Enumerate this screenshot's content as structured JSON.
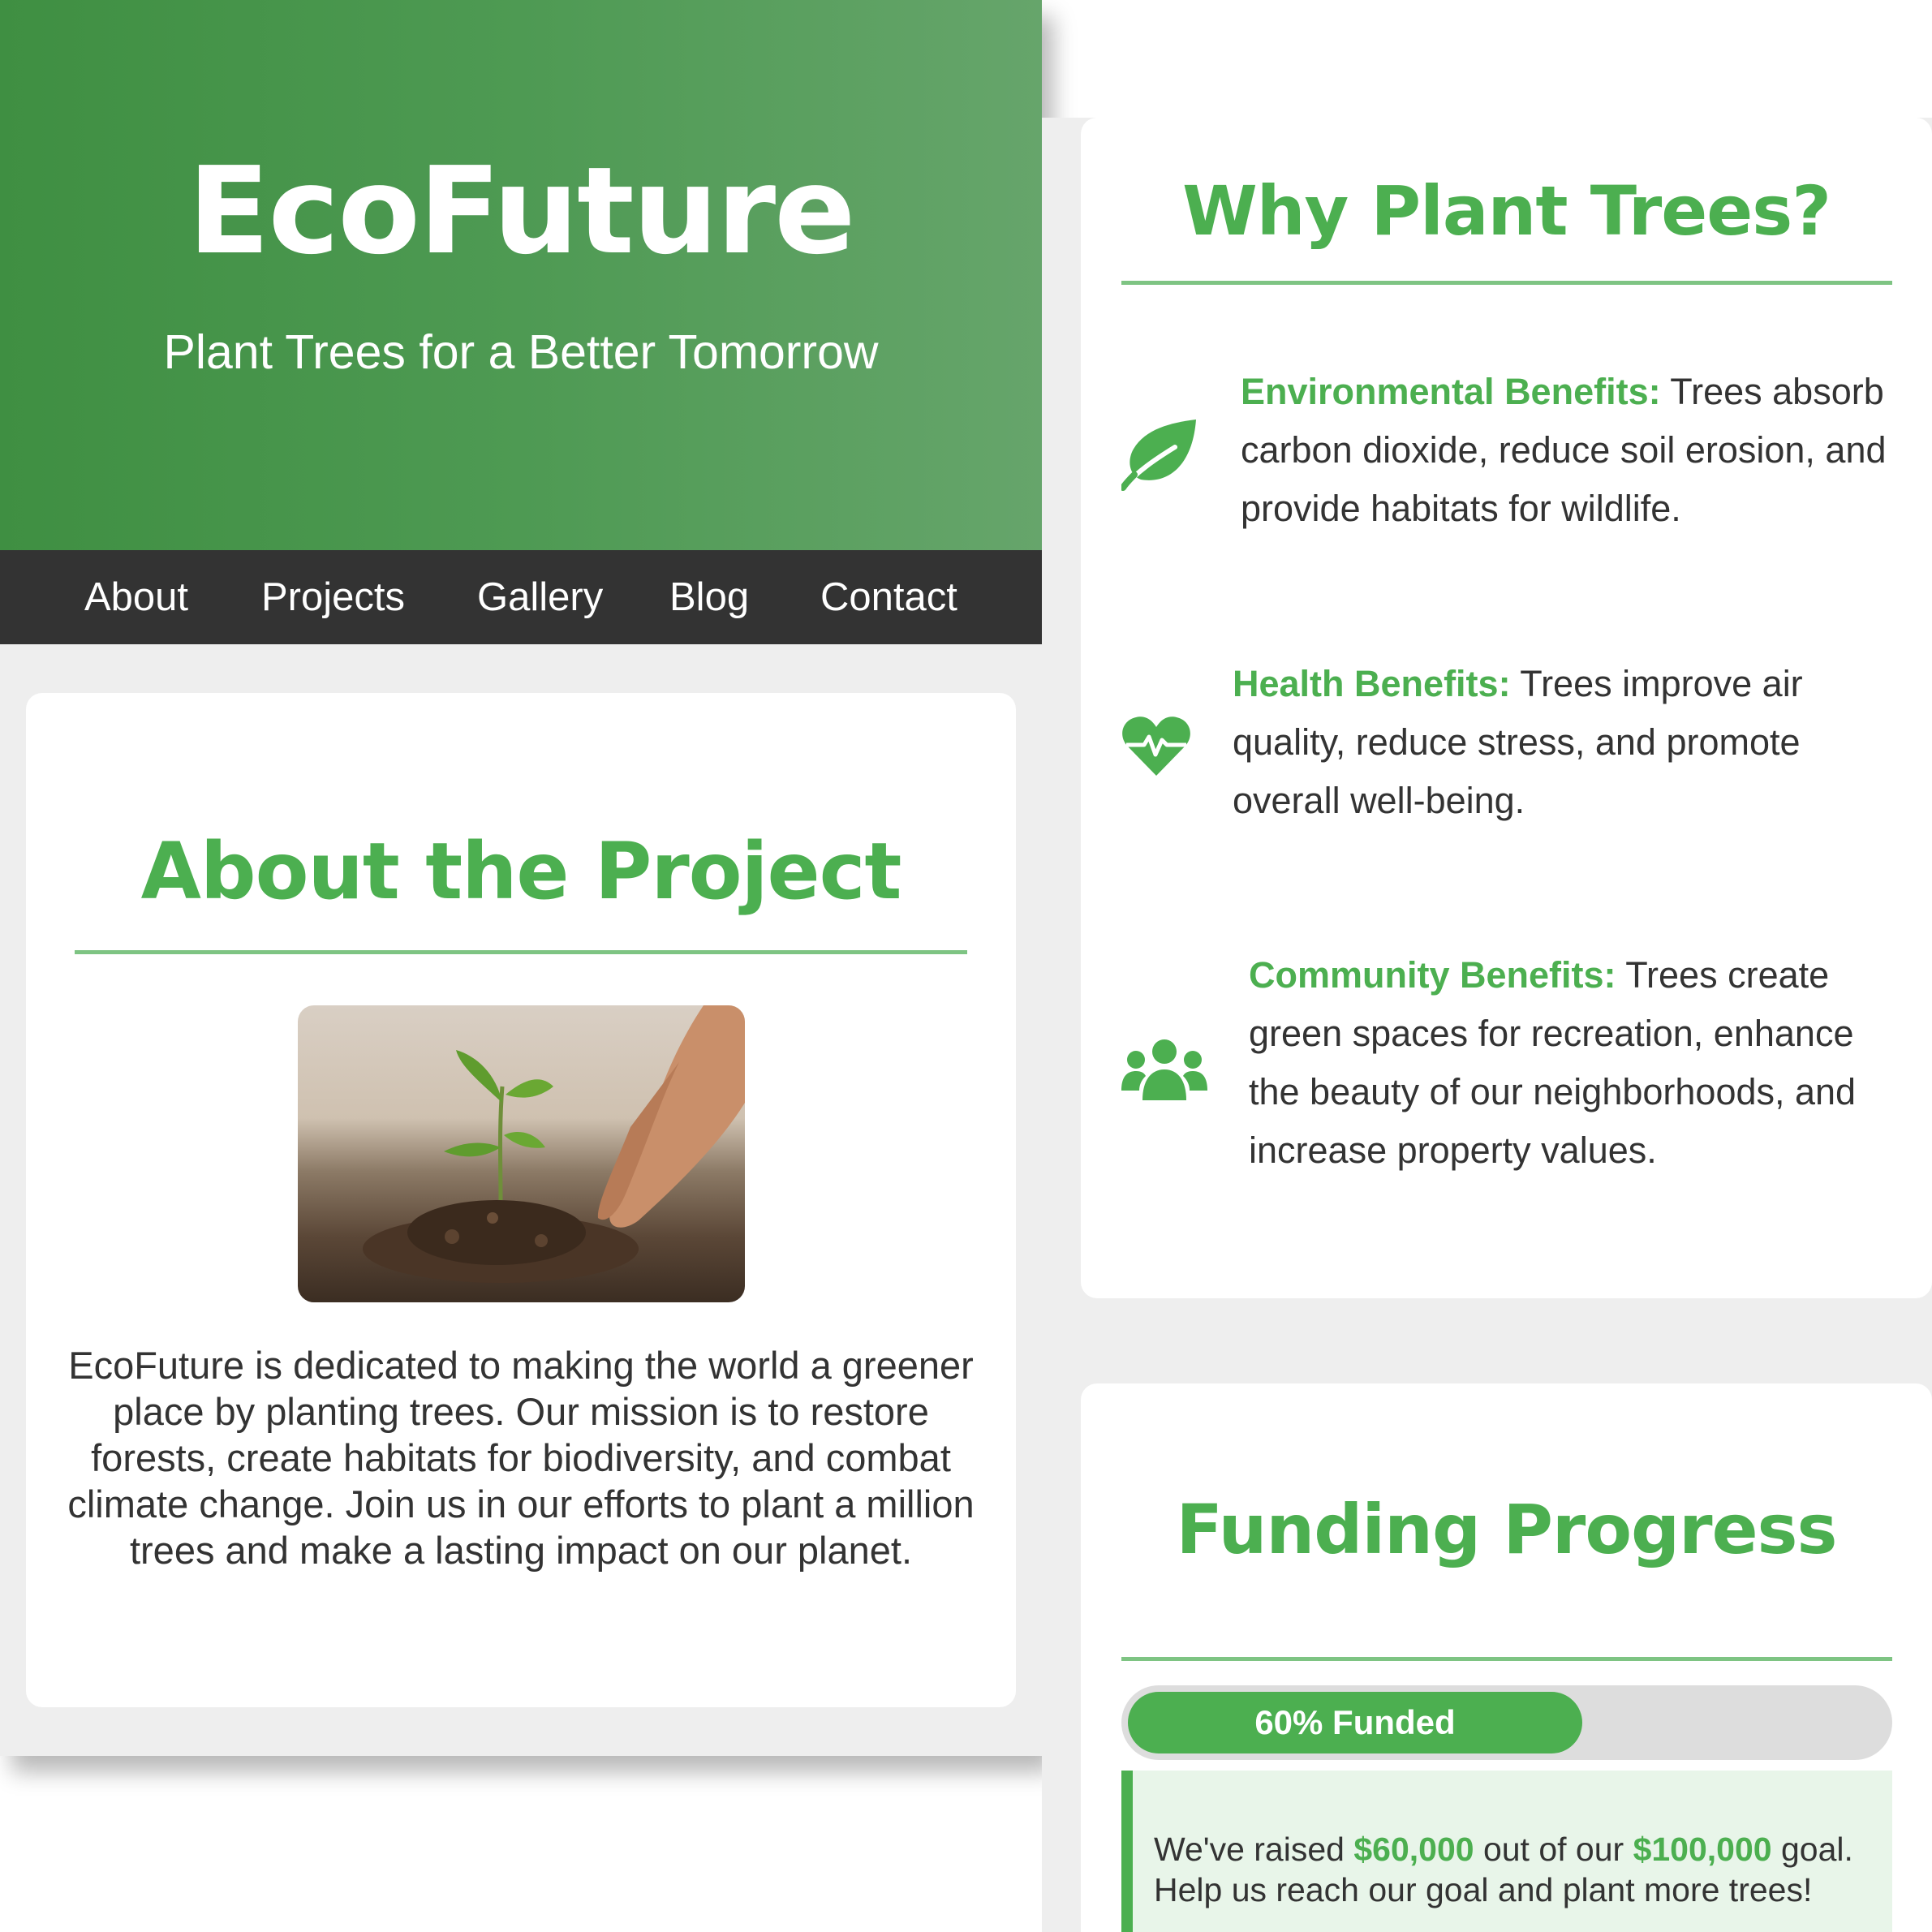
{
  "header": {
    "title": "EcoFuture",
    "tagline": "Plant Trees for a Better Tomorrow"
  },
  "nav": {
    "items": [
      {
        "label": "About"
      },
      {
        "label": "Projects"
      },
      {
        "label": "Gallery"
      },
      {
        "label": "Blog"
      },
      {
        "label": "Contact"
      }
    ]
  },
  "about": {
    "heading": "About the Project",
    "image_icon": "seedling-in-hand-photo",
    "text": "EcoFuture is dedicated to making the world a greener place by planting trees. Our mission is to restore forests, create habitats for biodiversity, and combat climate change. Join us in our efforts to plant a million trees and make a lasting impact on our planet."
  },
  "why": {
    "heading": "Why Plant Trees?",
    "benefits": [
      {
        "icon": "leaf-icon",
        "title": "Environmental Benefits:",
        "text": " Trees absorb carbon dioxide, reduce soil erosion, and provide habitats for wildlife."
      },
      {
        "icon": "heartbeat-icon",
        "title": "Health Benefits:",
        "text": " Trees improve air quality, reduce stress, and promote overall well-being."
      },
      {
        "icon": "users-icon",
        "title": "Community Benefits:",
        "text": " Trees create green spaces for recreation, enhance the beauty of our neighborhoods, and increase property values."
      }
    ]
  },
  "funding": {
    "heading": "Funding Progress",
    "progress_percent": 60,
    "progress_label": "60% Funded",
    "note_prefix": "We've raised ",
    "raised": "$60,000",
    "note_middle": " out of our ",
    "goal": "$100,000",
    "note_suffix": " goal. Help us reach our goal and plant more trees!"
  },
  "colors": {
    "accent": "#4caf50",
    "nav_bg": "#333333",
    "page_bg": "#eeeeee",
    "note_bg": "#e8f5e9"
  }
}
